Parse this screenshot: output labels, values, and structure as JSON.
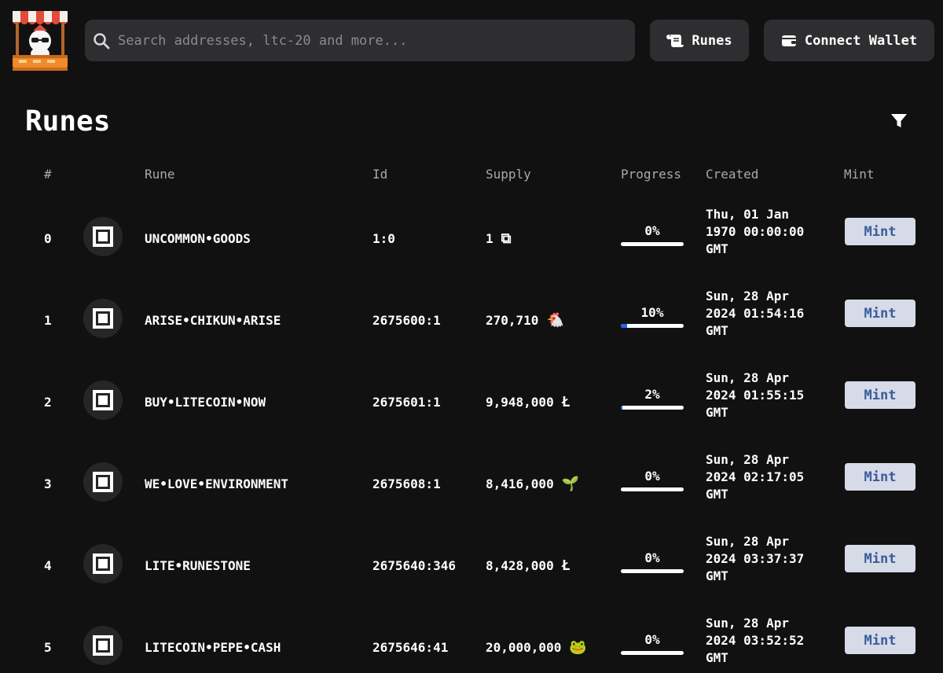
{
  "header": {
    "search_placeholder": "Search addresses, ltc-20 and more...",
    "runes_label": "Runes",
    "wallet_label": "Connect Wallet"
  },
  "page": {
    "title": "Runes"
  },
  "table": {
    "columns": {
      "num": "#",
      "rune": "Rune",
      "id": "Id",
      "supply": "Supply",
      "progress": "Progress",
      "created": "Created",
      "mint": "Mint"
    },
    "rows": [
      {
        "num": "0",
        "rune": "UNCOMMON•GOODS",
        "id": "1:0",
        "supply": "1",
        "symbol": "⧉",
        "progress_label": "0%",
        "progress": 0,
        "created_1": "Thu, 01 Jan",
        "created_2": "1970 00:00:00",
        "created_3": "GMT",
        "mint": "Mint"
      },
      {
        "num": "1",
        "rune": "ARISE•CHIKUN•ARISE",
        "id": "2675600:1",
        "supply": "270,710",
        "symbol": "🐔",
        "progress_label": "10%",
        "progress": 0.1,
        "created_1": "Sun, 28 Apr",
        "created_2": "2024 01:54:16",
        "created_3": "GMT",
        "mint": "Mint"
      },
      {
        "num": "2",
        "rune": "BUY•LITECOIN•NOW",
        "id": "2675601:1",
        "supply": "9,948,000",
        "symbol": "Ł",
        "progress_label": "2%",
        "progress": 0.02,
        "created_1": "Sun, 28 Apr",
        "created_2": "2024 01:55:15",
        "created_3": "GMT",
        "mint": "Mint"
      },
      {
        "num": "3",
        "rune": "WE•LOVE•ENVIRONMENT",
        "id": "2675608:1",
        "supply": "8,416,000",
        "symbol": "🌱",
        "progress_label": "0%",
        "progress": 0,
        "created_1": "Sun, 28 Apr",
        "created_2": "2024 02:17:05",
        "created_3": "GMT",
        "mint": "Mint"
      },
      {
        "num": "4",
        "rune": "LITE•RUNESTONE",
        "id": "2675640:346",
        "supply": "8,428,000",
        "symbol": "Ł",
        "progress_label": "0%",
        "progress": 0,
        "created_1": "Sun, 28 Apr",
        "created_2": "2024 03:37:37",
        "created_3": "GMT",
        "mint": "Mint"
      },
      {
        "num": "5",
        "rune": "LITECOIN•PEPE•CASH",
        "id": "2675646:41",
        "supply": "20,000,000",
        "symbol": "🐸",
        "progress_label": "0%",
        "progress": 0,
        "created_1": "Sun, 28 Apr",
        "created_2": "2024 03:52:52",
        "created_3": "GMT",
        "mint": "Mint"
      }
    ]
  },
  "colors": {
    "background": "#111112",
    "surface": "#2e2e30",
    "mint_bg": "#d6dbe7",
    "mint_text": "#3b5b9c",
    "progress_fill": "#2563eb"
  }
}
